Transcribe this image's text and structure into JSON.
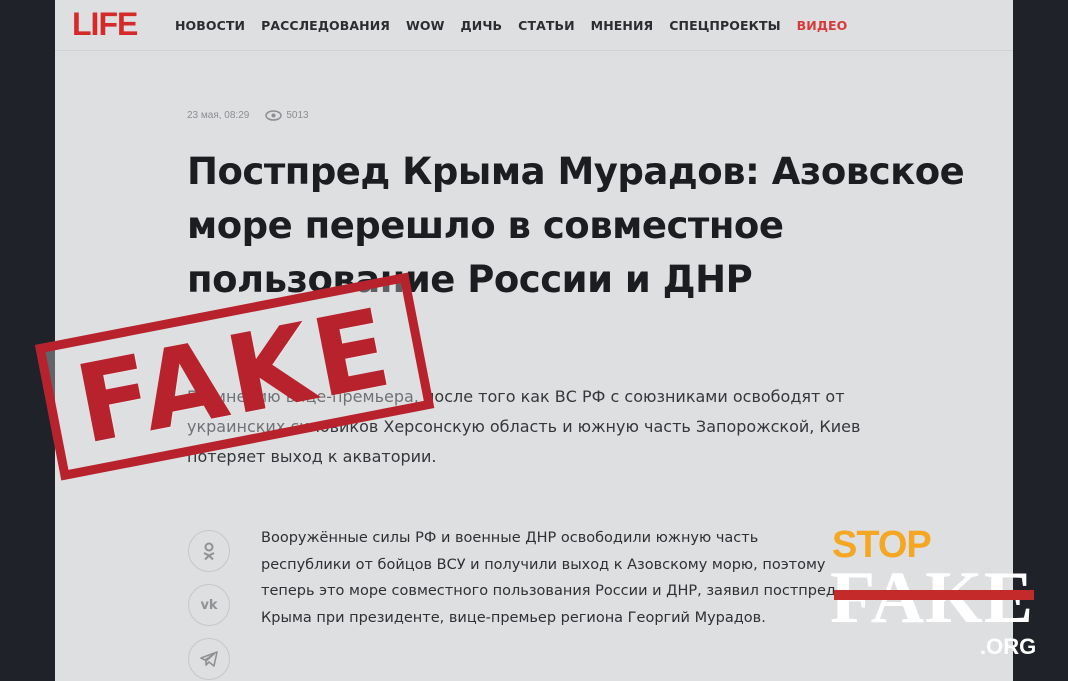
{
  "site": {
    "logo": "LIFE",
    "nav": [
      "НОВОСТИ",
      "РАССЛЕДОВАНИЯ",
      "WOW",
      "ДИЧЬ",
      "СТАТЬИ",
      "МНЕНИЯ",
      "СПЕЦПРОЕКТЫ",
      "ВИДЕО"
    ],
    "accent_color": "#d62a2a"
  },
  "article": {
    "date": "23 мая, 08:29",
    "views": "5013",
    "headline": "Постпред Крыма Мурадов: Азовское море перешло в совместное пользование России и ДНР",
    "lead": "По мнению вице-премьера, после того как ВС РФ с союзниками освободят от украинских силовиков Херсонскую область и южную часть Запорожской, Киев потеряет выход к акватории.",
    "body": "Вооружённые силы РФ и военные ДНР освободили южную часть республики от бойцов ВСУ и получили выход к Азовскому морю, поэтому теперь это море совместного пользования России и ДНР, заявил постпред Крыма при президенте, вице-премьер региона Георгий Мурадов."
  },
  "share": [
    {
      "icon": "odnoklassniki-icon",
      "glyph": "ok"
    },
    {
      "icon": "vk-icon",
      "glyph": "vk"
    },
    {
      "icon": "telegram-icon",
      "glyph": "➤"
    }
  ],
  "stamp": {
    "text": "FAKE",
    "color": "#b8222c"
  },
  "watermark": {
    "line1": "STOP",
    "line2": "FAKE",
    "line3": ".ORG",
    "orange": "#f5a623",
    "red": "#c42a2a"
  }
}
